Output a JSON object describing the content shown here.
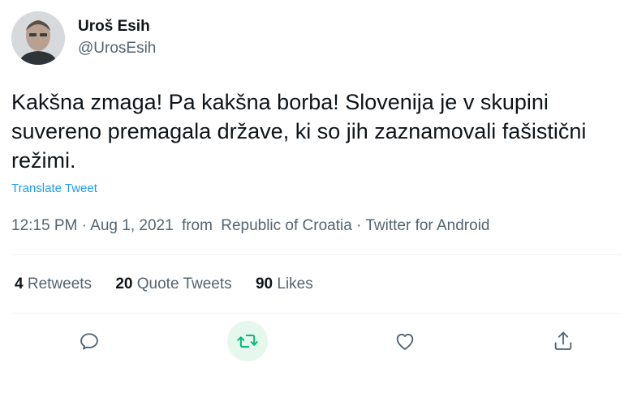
{
  "author": {
    "name": "Uroš Esih",
    "handle": "@UrosEsih"
  },
  "tweet": {
    "text": "Kakšna zmaga! Pa kakšna borba! Slovenija je v skupini suvereno premagala države, ki so jih zaznamovali fašistični režimi.",
    "translate_label": "Translate Tweet",
    "time": "12:15 PM",
    "date": "Aug 1, 2021",
    "from_prefix": "from",
    "location": "Republic of Croatia",
    "source": "Twitter for Android"
  },
  "stats": {
    "retweets": {
      "count": "4",
      "label": "Retweets"
    },
    "quote_tweets": {
      "count": "20",
      "label": "Quote Tweets"
    },
    "likes": {
      "count": "90",
      "label": "Likes"
    }
  },
  "actions": {
    "reply_icon": "reply-icon",
    "retweet_icon": "retweet-icon",
    "like_icon": "heart-icon",
    "share_icon": "share-icon"
  },
  "colors": {
    "accent": "#1d9bf0",
    "retweet_active": "#00ba7c",
    "muted": "#536471"
  }
}
